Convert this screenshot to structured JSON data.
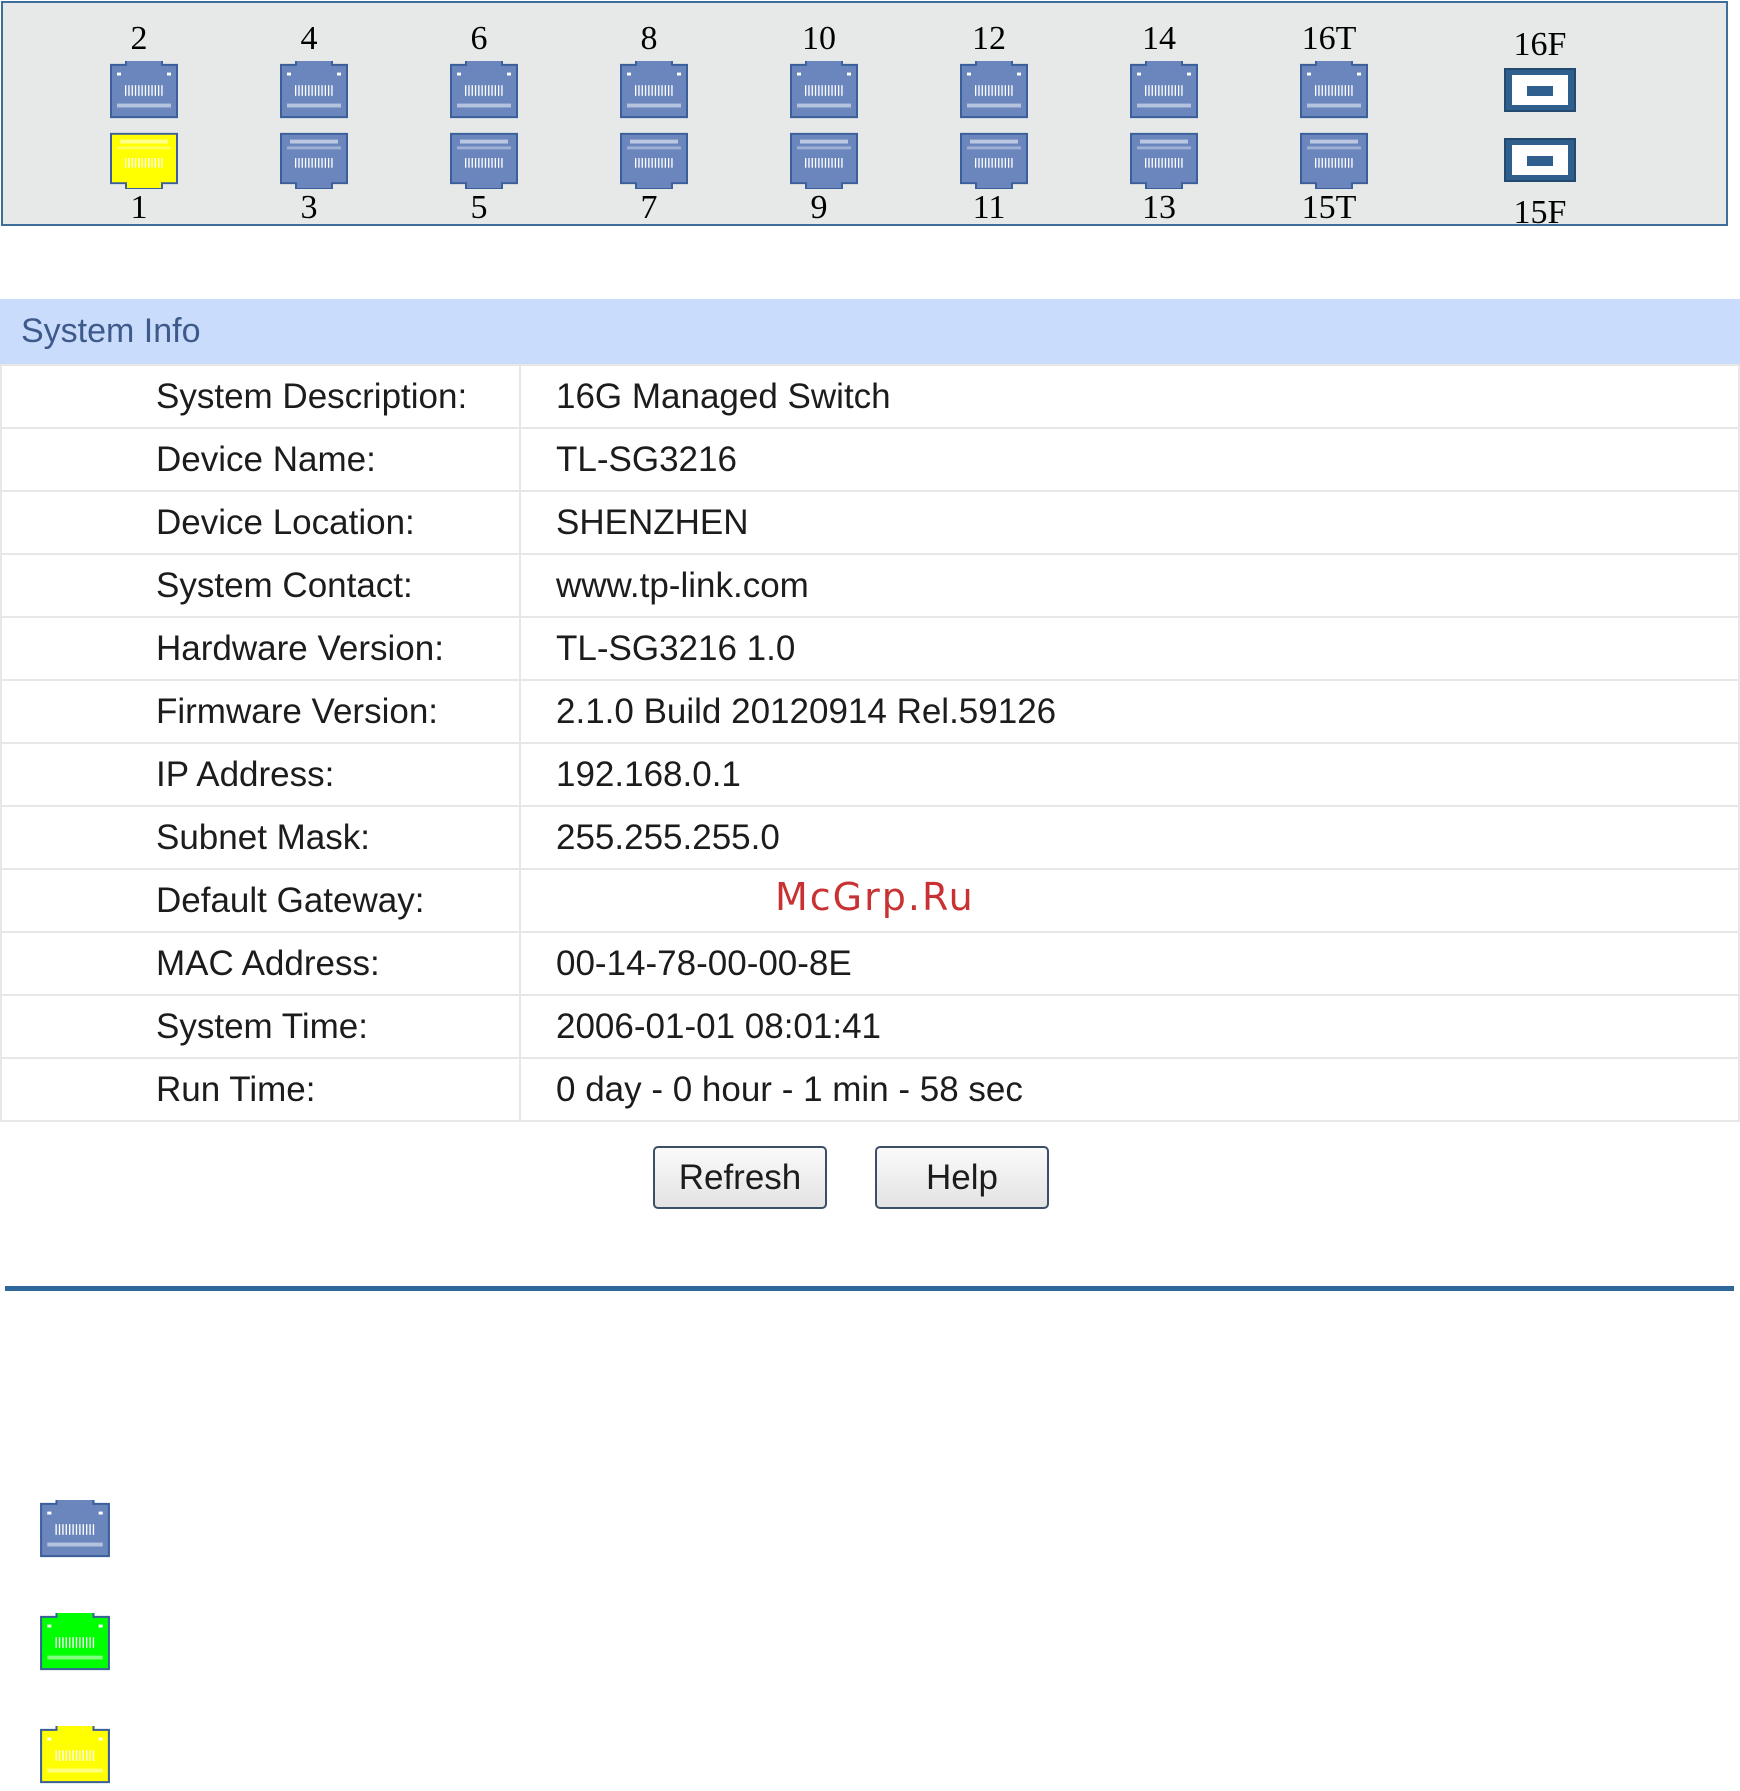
{
  "switch_panel": {
    "columns": [
      {
        "top": "2",
        "bottom": "1",
        "top_color": "#6b86bd",
        "bottom_color": "#ffff00"
      },
      {
        "top": "4",
        "bottom": "3",
        "top_color": "#6b86bd",
        "bottom_color": "#6b86bd"
      },
      {
        "top": "6",
        "bottom": "5",
        "top_color": "#6b86bd",
        "bottom_color": "#6b86bd"
      },
      {
        "top": "8",
        "bottom": "7",
        "top_color": "#6b86bd",
        "bottom_color": "#6b86bd"
      },
      {
        "top": "10",
        "bottom": "9",
        "top_color": "#6b86bd",
        "bottom_color": "#6b86bd"
      },
      {
        "top": "12",
        "bottom": "11",
        "top_color": "#6b86bd",
        "bottom_color": "#6b86bd"
      },
      {
        "top": "14",
        "bottom": "13",
        "top_color": "#6b86bd",
        "bottom_color": "#6b86bd"
      },
      {
        "top": "16T",
        "bottom": "15T",
        "top_color": "#6b86bd",
        "bottom_color": "#6b86bd"
      }
    ],
    "sfp": {
      "top": "16F",
      "bottom": "15F",
      "color": "#2f5f8c"
    }
  },
  "system_info": {
    "header": "System Info",
    "rows": [
      {
        "label": "System Description:",
        "value": "16G Managed Switch"
      },
      {
        "label": "Device Name:",
        "value": "TL-SG3216"
      },
      {
        "label": "Device Location:",
        "value": "SHENZHEN"
      },
      {
        "label": "System Contact:",
        "value": "www.tp-link.com"
      },
      {
        "label": "Hardware Version:",
        "value": "TL-SG3216 1.0"
      },
      {
        "label": "Firmware Version:",
        "value": "2.1.0 Build 20120914 Rel.59126"
      },
      {
        "label": "IP Address:",
        "value": "192.168.0.1"
      },
      {
        "label": "Subnet Mask:",
        "value": "255.255.255.0"
      },
      {
        "label": "Default Gateway:",
        "value": ""
      },
      {
        "label": "MAC Address:",
        "value": "00-14-78-00-00-8E"
      },
      {
        "label": "System Time:",
        "value": "2006-01-01 08:01:41"
      },
      {
        "label": "Run Time:",
        "value": "0 day - 0 hour - 1 min - 58 sec"
      }
    ]
  },
  "buttons": {
    "refresh": "Refresh",
    "help": "Help"
  },
  "watermark": "McGrp.Ru",
  "legend": {
    "unlinked_color": "#6b86bd",
    "link_1000_color": "#00ff00",
    "link_100_color": "#ffff00"
  },
  "colors": {
    "panel_border": "#3f6e9c",
    "header_bg": "#c9dcfb",
    "divider": "#2e6799"
  }
}
